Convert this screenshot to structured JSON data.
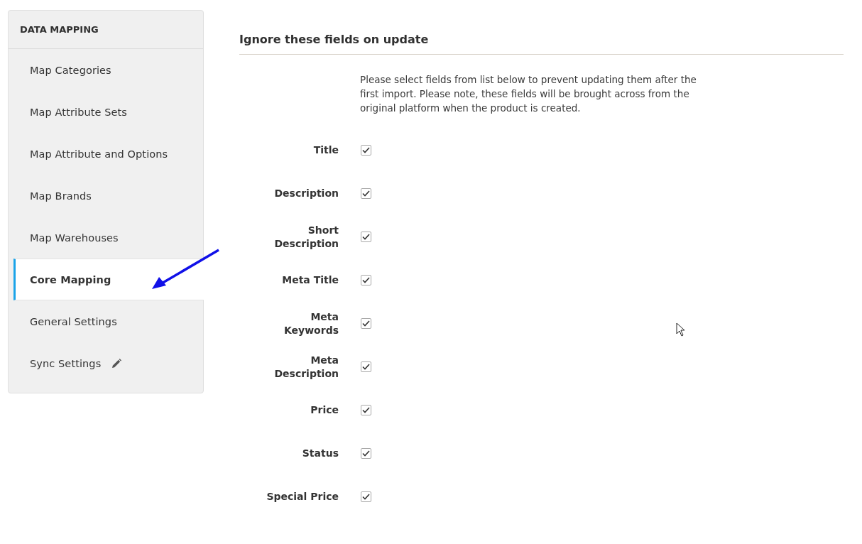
{
  "sidebar": {
    "title": "DATA MAPPING",
    "items": [
      {
        "label": "Map Categories",
        "selected": false,
        "kind": "plain"
      },
      {
        "label": "Map Attribute Sets",
        "selected": false,
        "kind": "plain"
      },
      {
        "label": "Map Attribute and Options",
        "selected": false,
        "kind": "plain"
      },
      {
        "label": "Map Brands",
        "selected": false,
        "kind": "plain"
      },
      {
        "label": "Map Warehouses",
        "selected": false,
        "kind": "plain"
      },
      {
        "label": "Core Mapping",
        "selected": true,
        "kind": "plain"
      },
      {
        "label": "General Settings",
        "selected": false,
        "kind": "plain"
      },
      {
        "label": "Sync Settings",
        "selected": false,
        "kind": "edited"
      }
    ]
  },
  "section": {
    "title": "Ignore these fields on update",
    "note": "Please select fields from list below to prevent updating them after the first import. Please note, these fields will be brought across from the original platform when the product is created.",
    "fields": [
      {
        "label": "Title",
        "checked": true
      },
      {
        "label": "Description",
        "checked": true
      },
      {
        "label": "Short Description",
        "checked": true
      },
      {
        "label": "Meta Title",
        "checked": true
      },
      {
        "label": "Meta Keywords",
        "checked": true
      },
      {
        "label": "Meta Description",
        "checked": true
      },
      {
        "label": "Price",
        "checked": true
      },
      {
        "label": "Status",
        "checked": true
      },
      {
        "label": "Special Price",
        "checked": true
      }
    ]
  }
}
